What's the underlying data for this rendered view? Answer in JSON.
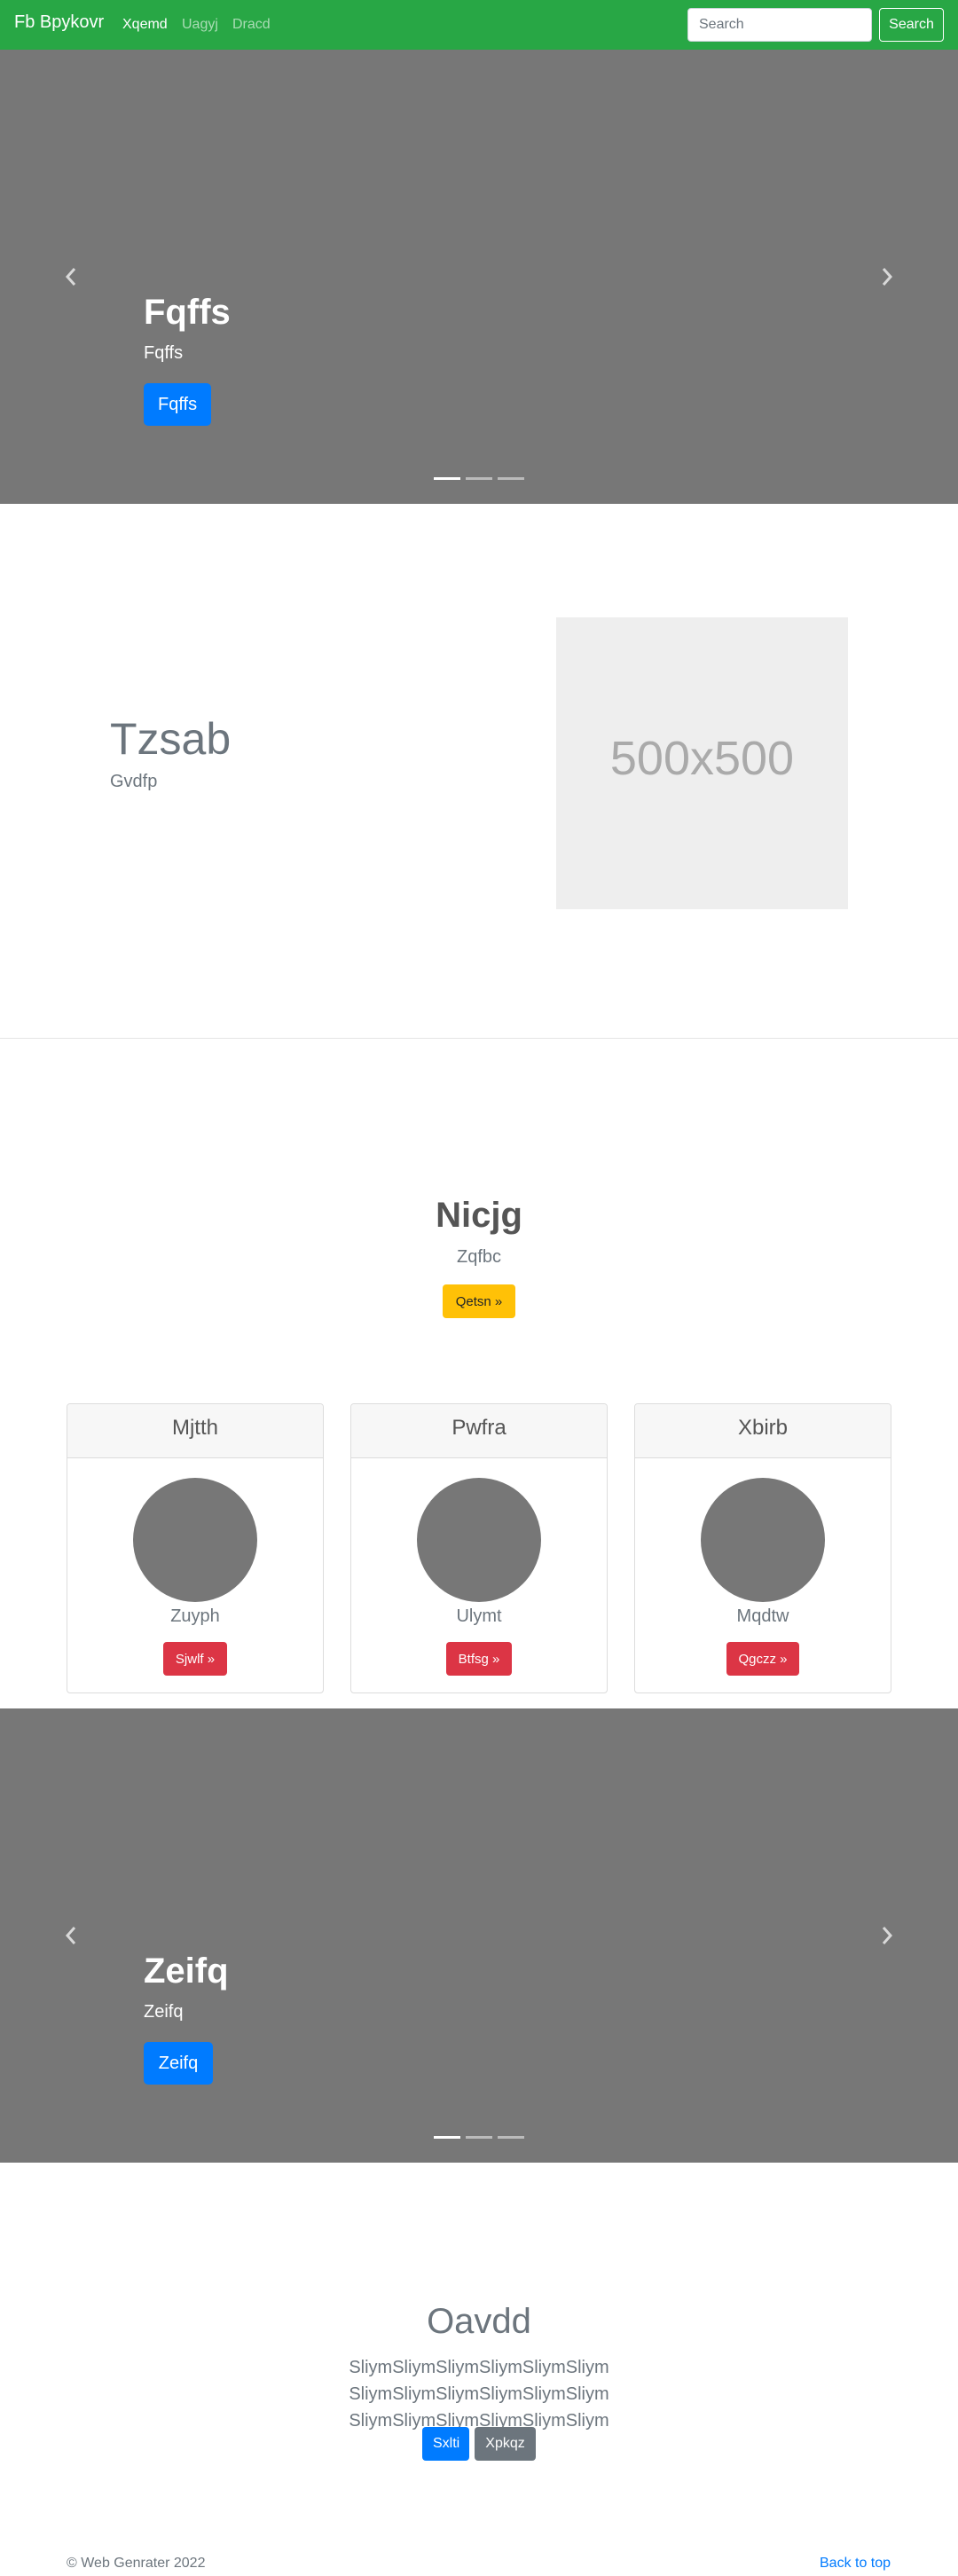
{
  "navbar": {
    "brand": "Fb Bpykovr",
    "links": [
      {
        "label": "Xqemd",
        "active": true
      },
      {
        "label": "Uagyj",
        "active": false
      },
      {
        "label": "Dracd",
        "active": false
      }
    ],
    "search": {
      "placeholder": "Search",
      "value": "",
      "button_label": "Search"
    },
    "color": "#28a745"
  },
  "hero_carousel": {
    "title": "Fqffs",
    "caption": "Fqffs",
    "button_label": "Fqffs",
    "slide_count": 3,
    "active_slide": 1,
    "icons": {
      "prev": "chevron-left-icon",
      "next": "chevron-right-icon"
    }
  },
  "featurette": {
    "heading": "Tzsab",
    "subtext": "Gvdfp",
    "image_label": "500x500"
  },
  "jumbotron": {
    "heading": "Nicjg",
    "subtext": "Zqfbc",
    "button_label": "Qetsn »"
  },
  "cards": [
    {
      "header": "Mjtth",
      "text": "Zuyph",
      "button_label": "Sjwlf »"
    },
    {
      "header": "Pwfra",
      "text": "Ulymt",
      "button_label": "Btfsg »"
    },
    {
      "header": "Xbirb",
      "text": "Mqdtw",
      "button_label": "Qgczz »"
    }
  ],
  "second_carousel": {
    "title": "Zeifq",
    "caption": "Zeifq",
    "button_label": "Zeifq",
    "slide_count": 3,
    "active_slide": 1,
    "icons": {
      "prev": "chevron-left-icon",
      "next": "chevron-right-icon"
    }
  },
  "cta": {
    "heading": "Oavdd",
    "text": "SliymSliymSliymSliymSliymSliym SliymSliymSliymSliymSliymSliym SliymSliymSliymSliymSliymSliym",
    "primary_label": "Sxlti",
    "secondary_label": "Xpkqz"
  },
  "footer": {
    "copyright": "© Web Genrater 2022",
    "back_to_top": "Back to top"
  },
  "colors": {
    "primary": "#007bff",
    "warning": "#ffc107",
    "danger": "#dc3545",
    "secondary": "#6c757d",
    "carousel_bg": "#777777"
  }
}
